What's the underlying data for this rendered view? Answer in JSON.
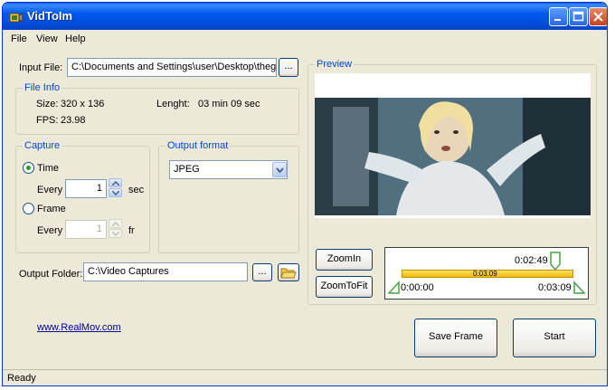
{
  "window": {
    "title": "VidToIm"
  },
  "menu": [
    "File",
    "View",
    "Help"
  ],
  "input_file": {
    "label": "Input File:",
    "value": "C:\\Documents and Settings\\user\\Desktop\\thegol",
    "browse_label": "..."
  },
  "file_info": {
    "title": "File Info",
    "size_label": "Size:",
    "size_value": "320 x 136",
    "length_label": "Lenght:",
    "length_value": "03 min 09 sec",
    "fps_label": "FPS:",
    "fps_value": "23.98"
  },
  "capture": {
    "title": "Capture",
    "time_label": "Time",
    "time_checked": true,
    "every_label": "Every",
    "time_every_value": "1",
    "time_unit": "sec",
    "frame_label": "Frame",
    "frame_every_value": "1",
    "frame_unit": "fr"
  },
  "output_format": {
    "title": "Output format",
    "selected": "JPEG"
  },
  "output_folder": {
    "label": "Output Folder:",
    "value": "C:\\Video Captures",
    "browse_label": "..."
  },
  "preview": {
    "title": "Preview",
    "zoom_in_label": "ZoomIn",
    "zoom_fit_label": "ZoomToFit"
  },
  "timeline": {
    "current_time": "0:02:49",
    "bar_label": "0:03:09",
    "start_time": "0:00:00",
    "end_time": "0:03:09",
    "marker_fraction": 0.894
  },
  "link": "www.RealMov.com",
  "buttons": {
    "save_frame": "Save Frame",
    "start": "Start"
  },
  "status": "Ready",
  "colors": {
    "titlebar": "#0058ee",
    "group_title": "#0046d5",
    "timeline_bar": "#f6c400",
    "marker": "#46a046"
  }
}
